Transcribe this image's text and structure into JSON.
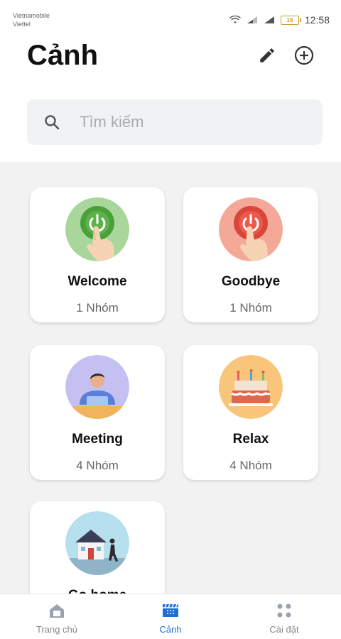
{
  "status_bar": {
    "carrier1": "Vietnamobile",
    "carrier2": "Viettel",
    "battery": "16",
    "time": "12:58"
  },
  "header": {
    "title": "Cảnh",
    "edit_icon": "pencil-icon",
    "add_icon": "plus-circle-icon"
  },
  "search": {
    "placeholder": "Tìm kiếm"
  },
  "scenes": [
    {
      "name": "Welcome",
      "count": "1 Nhóm",
      "icon": "power-press-green-icon"
    },
    {
      "name": "Goodbye",
      "count": "1 Nhóm",
      "icon": "power-press-red-icon"
    },
    {
      "name": "Meeting",
      "count": "4 Nhóm",
      "icon": "person-laptop-icon"
    },
    {
      "name": "Relax",
      "count": "4 Nhóm",
      "icon": "cake-icon"
    },
    {
      "name": "Go home",
      "count": "",
      "icon": "house-walking-icon"
    }
  ],
  "bottom_nav": [
    {
      "label": "Trang chủ",
      "icon": "home-icon"
    },
    {
      "label": "Cảnh",
      "icon": "scene-icon",
      "active": true
    },
    {
      "label": "Cài đặt",
      "icon": "grid-dots-icon"
    }
  ],
  "colors": {
    "accent": "#1f6fd6",
    "green_bg": "#a8d69b",
    "red_bg": "#f4a898",
    "purple_bg": "#c5c0f2",
    "orange_bg": "#f8c57a",
    "blue_bg": "#b7e0ef"
  }
}
